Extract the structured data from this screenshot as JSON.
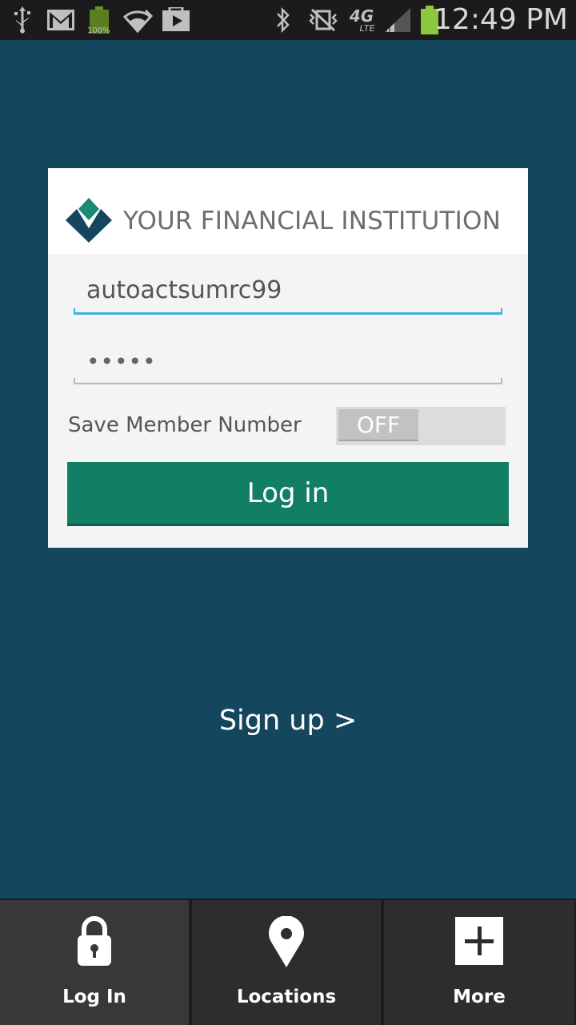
{
  "status_bar": {
    "time": "12:49 PM",
    "battery_badge": "100%",
    "network": "4G",
    "network_sub": "LTE"
  },
  "brand": {
    "name": "YOUR FINANCIAL INSTITUTION",
    "colors": {
      "dark": "#14465d",
      "green": "#127f65",
      "accent": "#3db4dc"
    }
  },
  "login_form": {
    "username_value": "autoactsumrc99",
    "password_masked": "•••••",
    "save_member_label": "Save Member Number",
    "save_member_toggle": "OFF",
    "login_button": "Log in"
  },
  "signup": {
    "label": "Sign up >"
  },
  "bottom_nav": {
    "items": [
      {
        "label": "Log In",
        "icon": "lock-icon"
      },
      {
        "label": "Locations",
        "icon": "location-pin-icon"
      },
      {
        "label": "More",
        "icon": "plus-box-icon"
      }
    ]
  }
}
